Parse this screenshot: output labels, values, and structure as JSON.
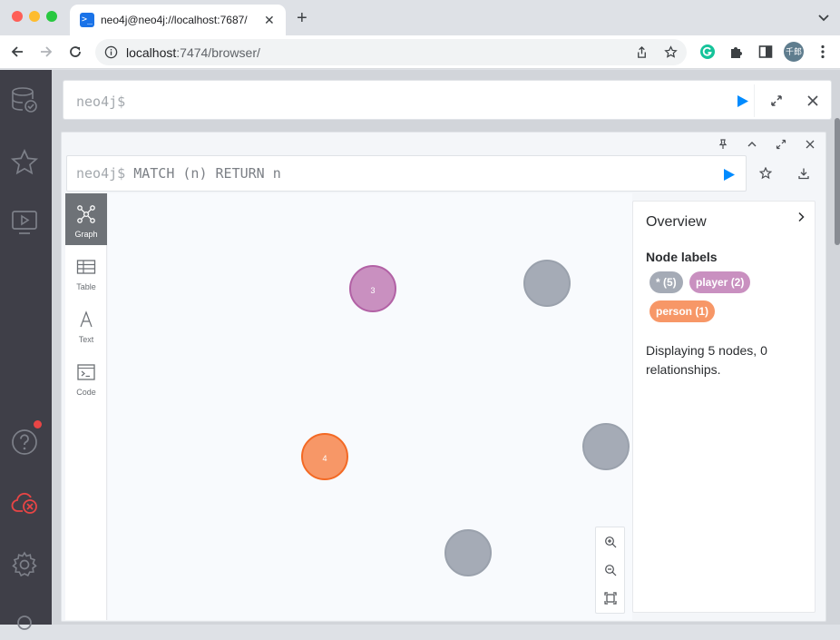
{
  "browser": {
    "tab_title": "neo4j@neo4j://localhost:7687/",
    "tab_favicon": ">_",
    "tab_close": "✕",
    "new_tab": "+",
    "url_host": "localhost",
    "url_rest": ":7474/browser/",
    "profile_label": "千郎"
  },
  "editor": {
    "prompt": "neo4j$"
  },
  "frame": {
    "prompt": "neo4j$",
    "query": "MATCH (n) RETURN n"
  },
  "views": [
    {
      "label": "Graph",
      "icon": "graph-icon",
      "active": true
    },
    {
      "label": "Table",
      "icon": "table-icon",
      "active": false
    },
    {
      "label": "Text",
      "icon": "text-icon",
      "active": false
    },
    {
      "label": "Code",
      "icon": "code-icon",
      "active": false
    }
  ],
  "nodes": [
    {
      "caption": "3",
      "label": "player",
      "color": "#c990c0"
    },
    {
      "caption": "",
      "label": "*",
      "color": "#a5abb6"
    },
    {
      "caption": "4",
      "label": "person",
      "color": "#f79767"
    },
    {
      "caption": "",
      "label": "*",
      "color": "#a5abb6"
    },
    {
      "caption": "",
      "label": "*",
      "color": "#a5abb6"
    }
  ],
  "overview": {
    "title": "Overview",
    "section": "Node labels",
    "labels": [
      {
        "text": "* (5)",
        "color": "#a5abb6"
      },
      {
        "text": "player (2)",
        "color": "#c990c0"
      },
      {
        "text": "person (1)",
        "color": "#f79767"
      }
    ],
    "description": "Displaying 5 nodes, 0 relationships."
  },
  "colors": {
    "accent": "#018bff",
    "sidebar": "#3f3f48"
  }
}
